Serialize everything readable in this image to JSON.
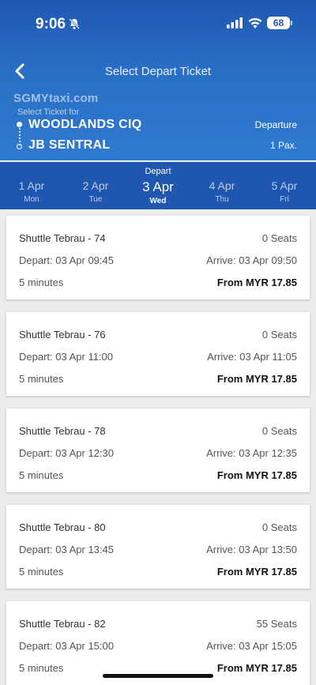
{
  "status_bar": {
    "time": "9:06",
    "battery": "68"
  },
  "header": {
    "title": "Select Depart Ticket",
    "watermark": "SGMYtaxi.com",
    "select_for": "Select Ticket for",
    "from": "WOODLANDS CIQ",
    "to": "JB SENTRAL",
    "direction": "Departure",
    "pax": "1 Pax."
  },
  "date_bar": {
    "label": "Depart",
    "dates": [
      {
        "day": "1 Apr",
        "weekday": "Mon"
      },
      {
        "day": "2 Apr",
        "weekday": "Tue"
      },
      {
        "day": "3 Apr",
        "weekday": "Wed",
        "active": true
      },
      {
        "day": "4 Apr",
        "weekday": "Thu"
      },
      {
        "day": "5 Apr",
        "weekday": "Fri"
      }
    ]
  },
  "tickets": [
    {
      "name": "Shuttle Tebrau - 74",
      "seats": "0 Seats",
      "depart": "Depart: 03 Apr 09:45",
      "arrive": "Arrive: 03 Apr 09:50",
      "duration": "5 minutes",
      "price": "From MYR 17.85"
    },
    {
      "name": "Shuttle Tebrau - 76",
      "seats": "0 Seats",
      "depart": "Depart: 03 Apr 11:00",
      "arrive": "Arrive: 03 Apr 11:05",
      "duration": "5 minutes",
      "price": "From MYR 17.85"
    },
    {
      "name": "Shuttle Tebrau - 78",
      "seats": "0 Seats",
      "depart": "Depart: 03 Apr 12:30",
      "arrive": "Arrive: 03 Apr 12:35",
      "duration": "5 minutes",
      "price": "From MYR 17.85"
    },
    {
      "name": "Shuttle Tebrau - 80",
      "seats": "0 Seats",
      "depart": "Depart: 03 Apr 13:45",
      "arrive": "Arrive: 03 Apr 13:50",
      "duration": "5 minutes",
      "price": "From MYR 17.85"
    },
    {
      "name": "Shuttle Tebrau - 82",
      "seats": "55 Seats",
      "depart": "Depart: 03 Apr 15:00",
      "arrive": "Arrive: 03 Apr 15:05",
      "duration": "5 minutes",
      "price": "From MYR 17.85"
    }
  ]
}
